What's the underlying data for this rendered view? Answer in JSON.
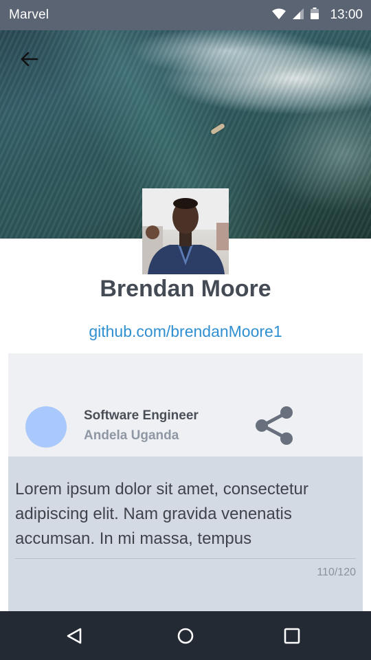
{
  "status_bar": {
    "app_name": "Marvel",
    "time": "13:00"
  },
  "profile": {
    "name": "Brendan Moore",
    "link": "github.com/brendanMoore1"
  },
  "card": {
    "job_title": "Software Engineer",
    "company": "Andela Uganda",
    "bio_text": "Lorem ipsum dolor sit amet, consectetur adipiscing elit. Nam gravida venenatis accumsan. In mi massa, tempus",
    "char_count": "110/120"
  },
  "icons": {
    "back": "arrow-back-icon",
    "share": "share-icon",
    "nav_back": "triangle-back-icon",
    "nav_home": "circle-home-icon",
    "nav_recents": "square-recents-icon"
  },
  "colors": {
    "status_bar": "#5b6473",
    "link": "#2f8fd1",
    "name": "#454b55",
    "avatar_placeholder": "#a9c8fb",
    "card_top": "#eef0f4",
    "card_bottom": "#d4dae3",
    "nav_bar": "#232a33"
  }
}
